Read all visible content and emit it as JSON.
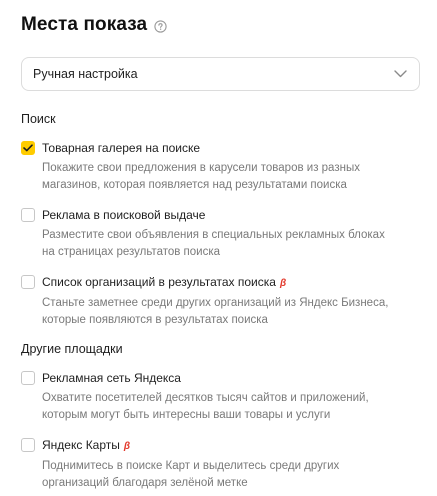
{
  "title": "Места показа",
  "select": {
    "value": "Ручная настройка"
  },
  "sections": [
    {
      "title": "Поиск",
      "options": [
        {
          "label": "Товарная галерея на поиске",
          "beta": "",
          "checked": true,
          "desc_line1": "Покажите свои предложения в карусели товаров из разных",
          "desc_line2": "магазинов, которая появляется над результатами поиска"
        },
        {
          "label": "Реклама в поисковой выдаче",
          "beta": "",
          "checked": false,
          "desc_line1": "Разместите свои объявления в специальных рекламных блоках",
          "desc_line2": "на страницах результатов поиска"
        },
        {
          "label": "Список организаций в результатах поиска",
          "beta": "β",
          "checked": false,
          "desc_line1": "Станьте заметнее среди других организаций из Яндекс Бизнеса,",
          "desc_line2": "которые появляются в результатах поиска"
        }
      ]
    },
    {
      "title": "Другие площадки",
      "options": [
        {
          "label": "Рекламная сеть Яндекса",
          "beta": "",
          "checked": false,
          "desc_line1": "Охватите посетителей десятков тысяч сайтов и приложений,",
          "desc_line2": "которым могут быть интересны ваши товары и услуги"
        },
        {
          "label": "Яндекс Карты",
          "beta": "β",
          "checked": false,
          "desc_line1": "Поднимитесь в поиске Карт и выделитесь среди других",
          "desc_line2": "организаций благодаря зелёной метке"
        }
      ]
    }
  ],
  "colors": {
    "checked_bg": "#ffcc00",
    "beta": "#e33b2e",
    "description": "#7a7a7a"
  }
}
